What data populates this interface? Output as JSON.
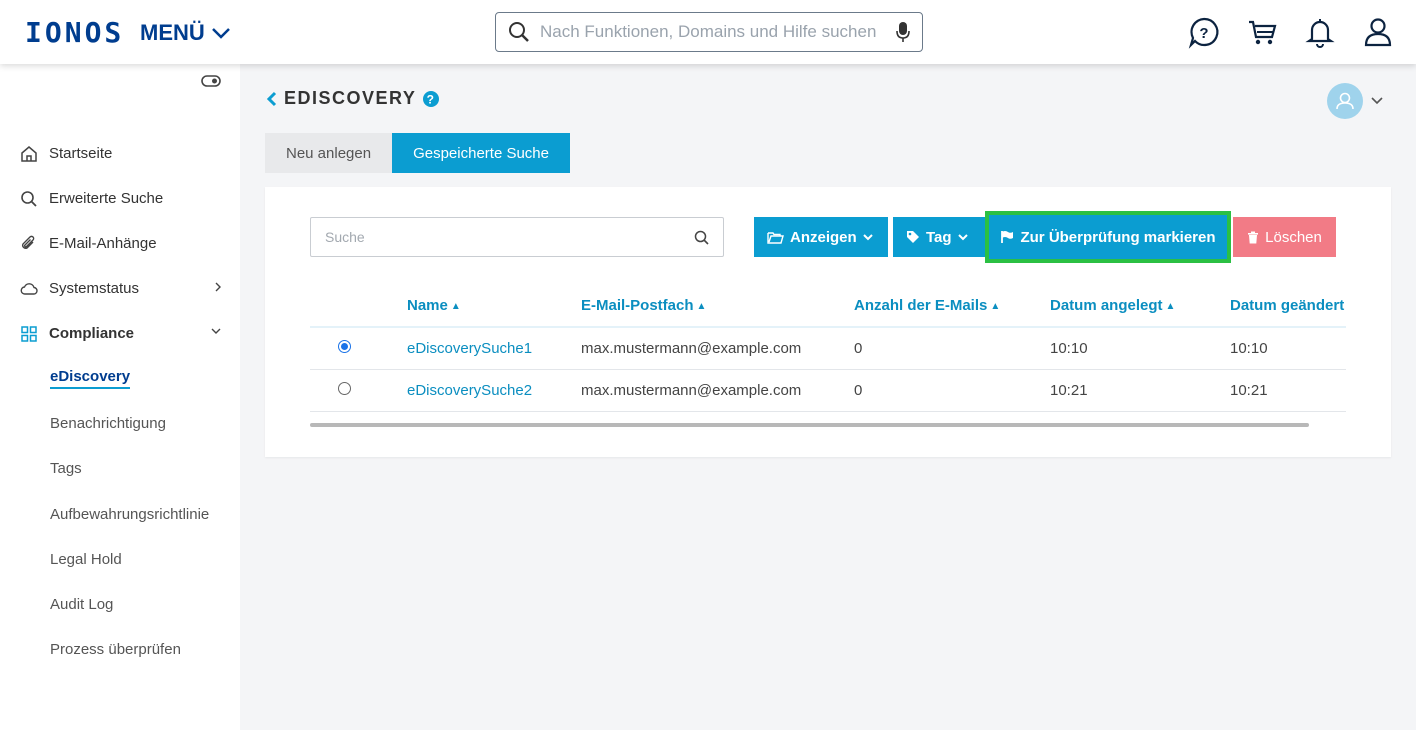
{
  "header": {
    "logo": "IONOS",
    "menu_label": "MENÜ",
    "search_placeholder": "Nach Funktionen, Domains und Hilfe suchen",
    "icons": [
      "help-chat-icon",
      "cart-icon",
      "bell-icon",
      "user-icon"
    ]
  },
  "sidebar": {
    "items": [
      {
        "label": "Startseite",
        "icon": "home-icon"
      },
      {
        "label": "Erweiterte Suche",
        "icon": "search-icon"
      },
      {
        "label": "E-Mail-Anhänge",
        "icon": "paperclip-icon"
      },
      {
        "label": "Systemstatus",
        "icon": "cloud-icon"
      },
      {
        "label": "Compliance",
        "icon": "grid-icon"
      }
    ],
    "subitems": [
      {
        "label": "eDiscovery"
      },
      {
        "label": "Benachrichtigung"
      },
      {
        "label": "Tags"
      },
      {
        "label": "Aufbewahrungsrichtlinie"
      },
      {
        "label": "Legal Hold"
      },
      {
        "label": "Audit Log"
      },
      {
        "label": "Prozess überprüfen"
      }
    ]
  },
  "page": {
    "title": "EDISCOVERY",
    "tabs": [
      {
        "label": "Neu anlegen",
        "active": false
      },
      {
        "label": "Gespeicherte Suche",
        "active": true
      }
    ]
  },
  "toolbar": {
    "search_placeholder": "Suche",
    "show_label": "Anzeigen",
    "tag_label": "Tag",
    "mark_label": "Zur Überprüfung markieren",
    "delete_label": "Löschen"
  },
  "table": {
    "columns": [
      "Name",
      "E-Mail-Postfach",
      "Anzahl der E-Mails",
      "Datum angelegt",
      "Datum geändert"
    ],
    "rows": [
      {
        "selected": true,
        "name": "eDiscoverySuche1",
        "mailbox": "max.mustermann@example.com",
        "count": "0",
        "created": "10:10",
        "modified": "10:10"
      },
      {
        "selected": false,
        "name": "eDiscoverySuche2",
        "mailbox": "max.mustermann@example.com",
        "count": "0",
        "created": "10:21",
        "modified": "10:21"
      }
    ]
  },
  "colors": {
    "brand": "#003d8f",
    "accent": "#0b9dd1",
    "danger": "#f27b86",
    "highlight": "#2bc043"
  }
}
